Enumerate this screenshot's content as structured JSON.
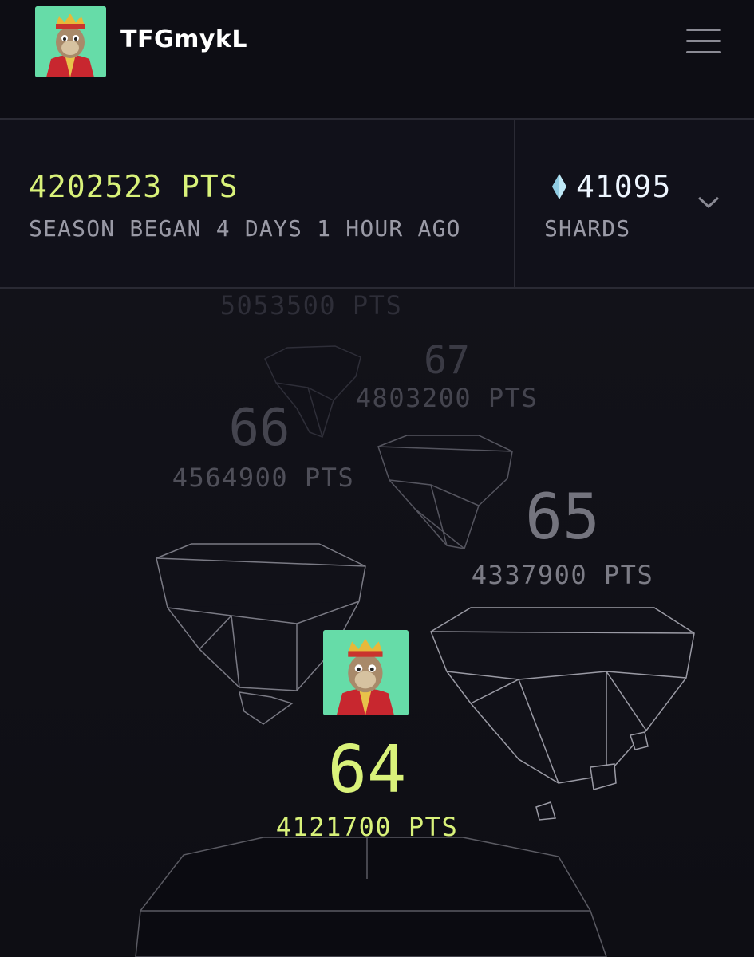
{
  "header": {
    "username": "TFGmykL",
    "avatar_icon": "ape-avatar-icon",
    "menu_icon": "hamburger-menu-icon"
  },
  "stats": {
    "points": "4202523 PTS",
    "season_text": "SEASON BEGAN 4 DAYS 1 HOUR AGO",
    "shards_value": "41095",
    "shards_label": "SHARDS",
    "shard_icon": "crystal-shard-icon",
    "dropdown_icon": "chevron-down-icon"
  },
  "leaderboard": {
    "rank_68": {
      "pts": "5053500 PTS"
    },
    "rank_67": {
      "rank": "67",
      "pts": "4803200 PTS"
    },
    "rank_66": {
      "rank": "66",
      "pts": "4564900 PTS"
    },
    "rank_65": {
      "rank": "65",
      "pts": "4337900 PTS"
    },
    "rank_64": {
      "rank": "64",
      "pts": "4121700 PTS",
      "is_current_player": true
    }
  },
  "colors": {
    "accent": "#d9f27a",
    "background": "#0f0f16",
    "muted_text": "#9a9aa6"
  }
}
